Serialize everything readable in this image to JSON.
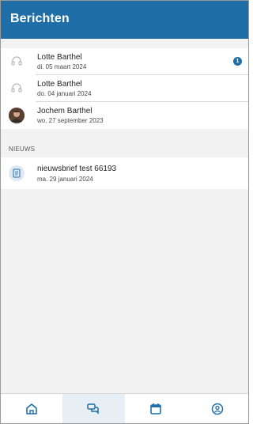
{
  "app": {
    "title": "Berichten"
  },
  "messages": [
    {
      "name": "Lotte Barthel",
      "date": "di. 05 maart 2024",
      "avatar": "headset-icon",
      "unread": "1"
    },
    {
      "name": "Lotte Barthel",
      "date": "do. 04 januari 2024",
      "avatar": "headset-icon"
    },
    {
      "name": "Jochem Barthel",
      "date": "wo. 27 september 2023",
      "avatar": "user-photo"
    }
  ],
  "news": {
    "section_label": "NIEUWS",
    "items": [
      {
        "name": "nieuwsbrief test 66193",
        "date": "ma. 29 januari 2024",
        "avatar": "newsletter-icon"
      }
    ]
  },
  "nav": {
    "items": [
      {
        "name": "home",
        "icon": "home-icon"
      },
      {
        "name": "messages",
        "icon": "chat-icon",
        "active": true
      },
      {
        "name": "calendar",
        "icon": "calendar-icon"
      },
      {
        "name": "profile",
        "icon": "profile-icon"
      }
    ]
  },
  "colors": {
    "header": "#1f6ea8",
    "badge": "#1f6ea8",
    "nav_active_bg": "#e7eef4"
  }
}
